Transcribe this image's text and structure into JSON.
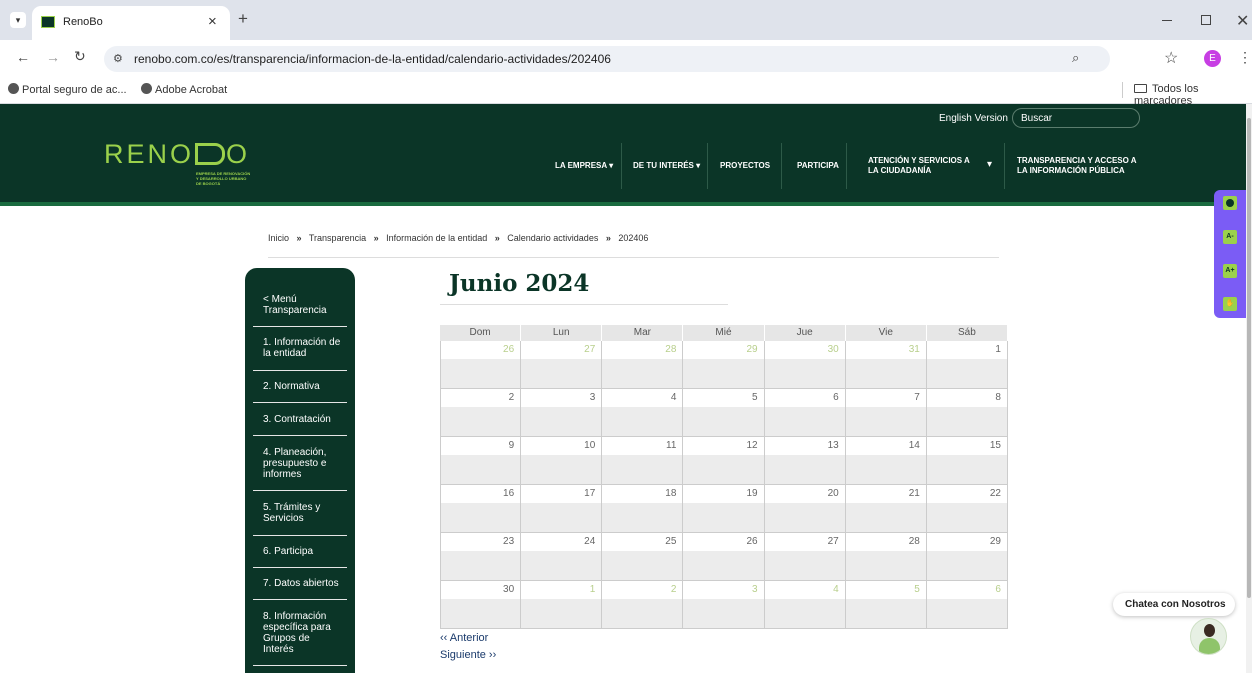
{
  "browser": {
    "tab_title": "RenoBo",
    "tab_close": "×",
    "new_tab": "+",
    "url": "renobo.com.co/es/transparencia/informacion-de-la-entidad/calendario-actividades/202406",
    "profile_initial": "E",
    "bookmarks": [
      "Portal seguro de ac...",
      "Adobe Acrobat"
    ],
    "all_bookmarks": "Todos los marcadores"
  },
  "header": {
    "logo_text": "RENOBO",
    "logo_sub": [
      "EMPRESA DE RENOVACIÓN",
      "Y DESARROLLO URBANO",
      "DE BOGOTÁ"
    ],
    "english_version": "English Version",
    "search_placeholder": "Buscar",
    "nav": [
      {
        "label": "LA EMPRESA",
        "chevron": true
      },
      {
        "label": "DE TU INTERÉS",
        "chevron": true
      },
      {
        "label": "PROYECTOS",
        "chevron": false
      },
      {
        "label": "PARTICIPA",
        "chevron": false
      },
      {
        "label": "ATENCIÓN Y SERVICIOS A LA CIUDADANÍA",
        "chevron": true
      },
      {
        "label": "TRANSPARENCIA Y ACCESO A LA INFORMACIÓN PÚBLICA",
        "chevron": false
      }
    ]
  },
  "breadcrumb": [
    "Inicio",
    "Transparencia",
    "Información de la entidad",
    "Calendario actividades",
    "202406"
  ],
  "breadcrumb_sep": "»",
  "sidebar": {
    "back": "< Menú Transparencia",
    "items": [
      "1. Información de la entidad",
      "2. Normativa",
      "3. Contratación",
      "4. Planeación, presupuesto e informes",
      "5. Trámites y Servicios",
      "6. Participa",
      "7. Datos abiertos",
      "8. Información específica para Grupos de Interés"
    ]
  },
  "calendar": {
    "title": "Junio 2024",
    "days": [
      "Dom",
      "Lun",
      "Mar",
      "Mié",
      "Jue",
      "Vie",
      "Sáb"
    ],
    "weeks": [
      [
        [
          "26",
          1
        ],
        [
          "27",
          1
        ],
        [
          "28",
          1
        ],
        [
          "29",
          1
        ],
        [
          "30",
          1
        ],
        [
          "31",
          1
        ],
        [
          "1",
          0
        ]
      ],
      [
        [
          "2",
          0
        ],
        [
          "3",
          0
        ],
        [
          "4",
          0
        ],
        [
          "5",
          0
        ],
        [
          "6",
          0
        ],
        [
          "7",
          0
        ],
        [
          "8",
          0
        ]
      ],
      [
        [
          "9",
          0
        ],
        [
          "10",
          0
        ],
        [
          "11",
          0
        ],
        [
          "12",
          0
        ],
        [
          "13",
          0
        ],
        [
          "14",
          0
        ],
        [
          "15",
          0
        ]
      ],
      [
        [
          "16",
          0
        ],
        [
          "17",
          0
        ],
        [
          "18",
          0
        ],
        [
          "19",
          0
        ],
        [
          "20",
          0
        ],
        [
          "21",
          0
        ],
        [
          "22",
          0
        ]
      ],
      [
        [
          "23",
          0
        ],
        [
          "24",
          0
        ],
        [
          "25",
          0
        ],
        [
          "26",
          0
        ],
        [
          "27",
          0
        ],
        [
          "28",
          0
        ],
        [
          "29",
          0
        ]
      ],
      [
        [
          "30",
          0
        ],
        [
          "1",
          1
        ],
        [
          "2",
          1
        ],
        [
          "3",
          1
        ],
        [
          "4",
          1
        ],
        [
          "5",
          1
        ],
        [
          "6",
          1
        ]
      ]
    ],
    "prev": "‹‹ Anterior",
    "next": "Siguiente ››"
  },
  "chat": {
    "label": "Chatea con Nosotros"
  },
  "colors": {
    "brand_dark": "#0b3527",
    "accent_green": "#9bd14b",
    "widget_purple": "#7b5cf5"
  }
}
